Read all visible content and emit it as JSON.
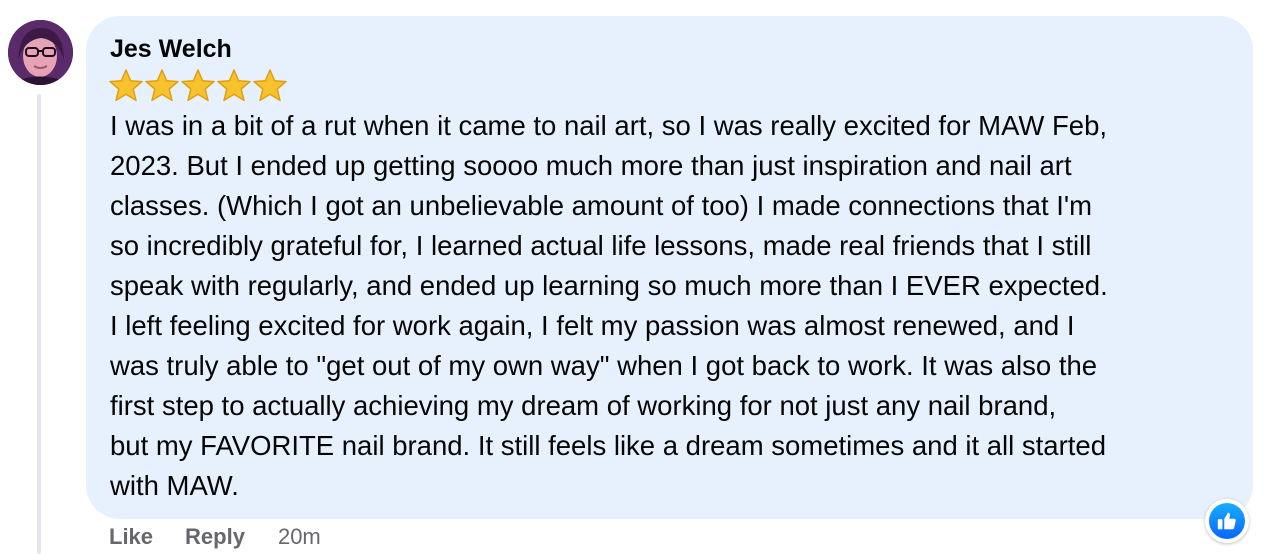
{
  "comment": {
    "author": "Jes Welch",
    "rating_stars": 5,
    "text": "I was in a bit of a rut when it came to nail art, so I was really excited for MAW Feb,\n2023. But I ended up getting soooo much more than just inspiration and nail art\nclasses. (Which I got an unbelievable amount of too) I made connections that I'm\nso incredibly grateful for, I learned actual life lessons, made real friends that I still\nspeak with regularly, and ended up learning so much more than I EVER expected.\nI left feeling excited for work again, I felt my passion was almost renewed, and I\nwas truly able to \"get out of my own way\" when I got back to work. It was also the\nfirst step to actually achieving my dream of working for not just any nail brand,\nbut my FAVORITE nail brand. It still feels like a dream sometimes and it all started\nwith MAW.",
    "reaction_icon": "like-reaction-icon"
  },
  "actions": {
    "like_label": "Like",
    "reply_label": "Reply",
    "timestamp": "20m"
  },
  "colors": {
    "bubble_background": "#e7f0fd",
    "secondary_text": "#65676b",
    "reaction_blue": "#0866ff",
    "star_gold": "#f7c22e"
  }
}
